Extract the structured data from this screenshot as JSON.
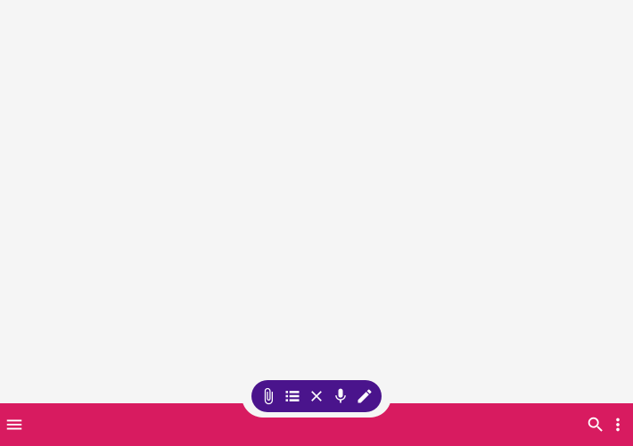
{
  "colors": {
    "background": "#f5f5f5",
    "app_bar": "#d81b60",
    "fab": "#4a148c",
    "icon": "#ffffff"
  },
  "bottom_app_bar": {
    "left_icons": [
      "menu-icon"
    ],
    "right_icons": [
      "search-icon",
      "more-vert-icon"
    ]
  },
  "fab_actions": [
    "attach-icon",
    "list-icon",
    "close-icon",
    "mic-icon",
    "edit-icon"
  ]
}
